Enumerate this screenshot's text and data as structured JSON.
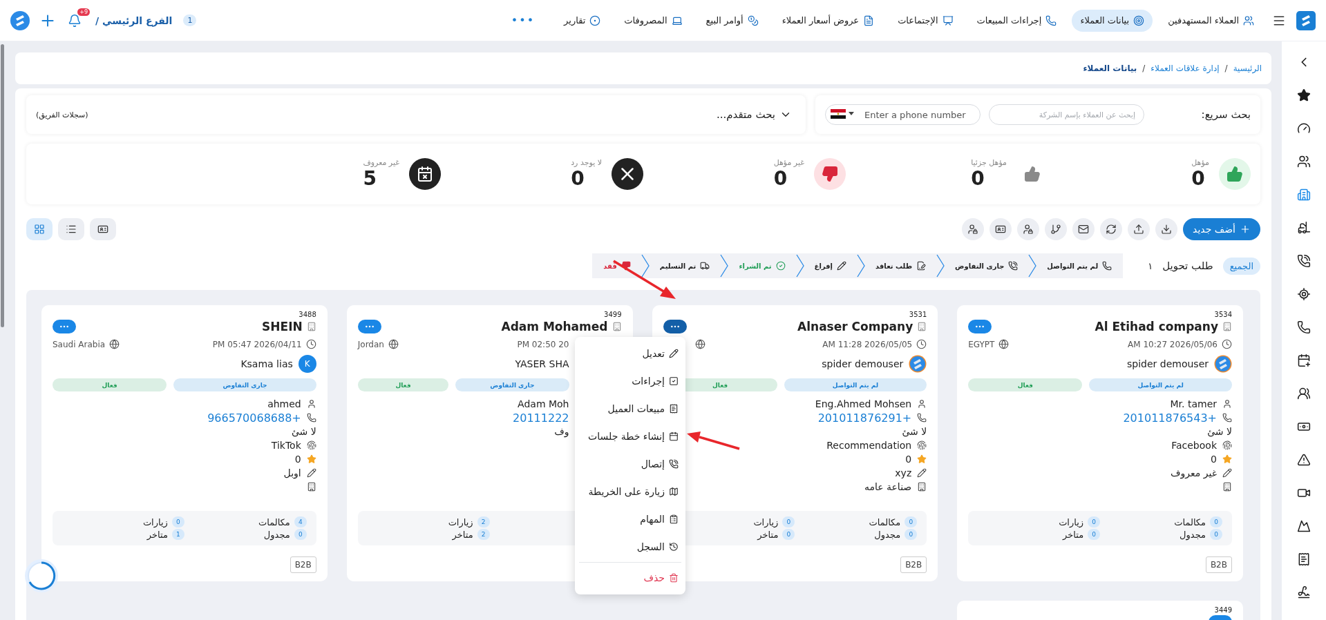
{
  "top_bar": {
    "nav": [
      {
        "label": "العملاء المستهدفين",
        "selected": false
      },
      {
        "label": "بيانات العملاء",
        "selected": true
      },
      {
        "label": "إجراءات المبيعات",
        "selected": false
      },
      {
        "label": "الإجتماعات",
        "selected": false
      },
      {
        "label": "عروض أسعار العملاء",
        "selected": false
      },
      {
        "label": "أوامر البيع",
        "selected": false
      },
      {
        "label": "المصروفات",
        "selected": false
      },
      {
        "label": "تقارير",
        "selected": false
      }
    ],
    "more": "•••",
    "branch": {
      "count": "1",
      "name": "الفرع الرئيسي /"
    },
    "notifications": "+9"
  },
  "sidebar": {
    "items": [
      {
        "selected": false
      },
      {
        "selected": false
      },
      {
        "selected": false
      },
      {
        "selected": true
      },
      {
        "selected": false
      },
      {
        "selected": false
      },
      {
        "selected": false
      },
      {
        "selected": false
      },
      {
        "selected": false
      },
      {
        "selected": false
      },
      {
        "selected": false
      },
      {
        "selected": false
      },
      {
        "selected": false
      },
      {
        "selected": false
      },
      {
        "selected": false
      },
      {
        "selected": false
      }
    ]
  },
  "breadcrumb": [
    {
      "label": "الرئيسية",
      "kind": "link"
    },
    {
      "label": "/",
      "kind": "separator"
    },
    {
      "label": "إدارة علاقات العملاء",
      "kind": "link"
    },
    {
      "label": "/",
      "kind": "separator"
    },
    {
      "label": "بيانات العملاء",
      "kind": "current"
    }
  ],
  "search": {
    "label": "بحث سريع:",
    "company_placeholder": "إبحث عن العملاء بإسم الشركة",
    "phone_placeholder": "Enter a phone number",
    "advanced": "بحث متقدم...",
    "team_records": "(سجلات الفريق)"
  },
  "summary": [
    {
      "kind": "qualified",
      "label": "مؤهل",
      "value": "0"
    },
    {
      "kind": "partial",
      "label": "مؤهل جزئيا",
      "value": "0"
    },
    {
      "kind": "unqualified",
      "label": "غير مؤهل",
      "value": "0"
    },
    {
      "kind": "no_reply",
      "label": "لا يوجد رد",
      "value": "0"
    },
    {
      "kind": "unknown",
      "label": "غير معروف",
      "value": "5"
    }
  ],
  "toolbar": {
    "add_label": "أضف جديد",
    "views": [
      {
        "selected": false
      },
      {
        "selected": false
      },
      {
        "selected": true
      }
    ]
  },
  "filter": {
    "all": {
      "label": "الجميع",
      "selected": true
    },
    "transfer": "طلب تحويل",
    "count": "١",
    "stages": [
      {
        "label": "لم يتم التواصل",
        "color": "#222222",
        "selected": false
      },
      {
        "label": "جارى التفاوض",
        "color": "#222222",
        "selected": false
      },
      {
        "label": "طلب تعاقد",
        "color": "#222222",
        "selected": false
      },
      {
        "label": "إفراغ",
        "color": "#222222",
        "selected": false
      },
      {
        "label": "تم الشراء",
        "color": "#1f9d55",
        "selected": false
      },
      {
        "label": "تم التسليم",
        "color": "#222222",
        "selected": false
      },
      {
        "label": "فُقد",
        "color": "#d9263b",
        "selected": false
      }
    ]
  },
  "cards": [
    {
      "id": "3534",
      "title": "Al Etihad company",
      "menu_open": false,
      "date": "AM 10:27 2026/05/06",
      "country": "EGYPT",
      "owner": {
        "name": "spider demouser",
        "kind": "logo"
      },
      "tags": [
        {
          "label": "لم يتم التواصل",
          "color": "#1a7fd4"
        },
        {
          "label": "فعال",
          "color": "#1f9d55"
        }
      ],
      "details": [
        {
          "kind": "person",
          "text": "Mr. tamer"
        },
        {
          "kind": "phone",
          "text": "201011876543+"
        },
        {
          "kind": "plain",
          "text": "لا شئ"
        },
        {
          "kind": "source",
          "text": "Facebook"
        },
        {
          "kind": "rating",
          "text": "0"
        },
        {
          "kind": "note",
          "text": "غير معروف"
        },
        {
          "kind": "industry"
        }
      ],
      "stats": {
        "column_1": [
          {
            "label": "مكالمات",
            "count": "0"
          },
          {
            "label": "مجدول",
            "count": "0"
          }
        ],
        "column_2": [
          {
            "label": "زيارات",
            "count": "0"
          },
          {
            "label": "متاخر",
            "count": "0"
          }
        ]
      },
      "badge": "B2B"
    },
    {
      "id": "3531",
      "title": "Alnaser Company",
      "menu_open": true,
      "date": "AM 11:28 2026/05/05",
      "owner": {
        "name": "spider demouser",
        "kind": "logo"
      },
      "tags": [
        {
          "label": "لم يتم التواصل",
          "color": "#1a7fd4"
        },
        {
          "label": "فعال",
          "color": "#1f9d55"
        }
      ],
      "details": [
        {
          "kind": "person",
          "text": "Eng.Ahmed Mohsen"
        },
        {
          "kind": "phone",
          "text": "201011876291+"
        },
        {
          "kind": "plain",
          "text": "لا شئ"
        },
        {
          "kind": "source",
          "text": "Recommendation"
        },
        {
          "kind": "rating",
          "text": "0"
        },
        {
          "kind": "note",
          "text": "xyz"
        },
        {
          "kind": "industry",
          "text": "صناعة عامه"
        }
      ],
      "stats": {
        "column_1": [
          {
            "label": "مكالمات",
            "count": "0"
          },
          {
            "label": "مجدول",
            "count": "0"
          }
        ],
        "column_2": [
          {
            "label": "زيارات",
            "count": "0"
          },
          {
            "label": "متاخر",
            "count": "0"
          }
        ]
      },
      "badge": "B2B"
    },
    {
      "id": "3499",
      "title": "Adam Mohamed",
      "menu_open": false,
      "covered": true,
      "date": "PM 02:50 20",
      "country": "Jordan",
      "owner": {
        "name": "YASER SHA"
      },
      "tags": [
        {
          "label": "جارى التفاوض",
          "color": "#1a7fd4"
        },
        {
          "label": "فعال",
          "color": "#1f9d55"
        }
      ],
      "details": [
        {
          "kind": "person",
          "text": "Adam Moh"
        },
        {
          "kind": "phone",
          "text": "20111222"
        },
        {
          "kind": "note",
          "text": "وف"
        }
      ],
      "stats": {
        "column_2": [
          {
            "label": "زيارات",
            "count": "2"
          },
          {
            "label": "متاخر",
            "count": "2"
          }
        ]
      }
    },
    {
      "id": "3488",
      "title": "SHEIN",
      "menu_open": false,
      "date": "PM 05:47 2026/04/11",
      "country": "Saudi Arabia",
      "owner": {
        "name": "Ksama lias",
        "kind": "letter",
        "avatar_letter": "K"
      },
      "tags": [
        {
          "label": "جارى التفاوض",
          "color": "#1a7fd4"
        },
        {
          "label": "فعال",
          "color": "#1f9d55"
        }
      ],
      "details": [
        {
          "kind": "person",
          "text": "ahmed"
        },
        {
          "kind": "phone",
          "text": "966570068688+"
        },
        {
          "kind": "plain",
          "text": "لا شئ"
        },
        {
          "kind": "source",
          "text": "TikTok"
        },
        {
          "kind": "rating",
          "text": "0"
        },
        {
          "kind": "note",
          "text": "اوبل"
        },
        {
          "kind": "industry"
        }
      ],
      "stats": {
        "column_1": [
          {
            "label": "مكالمات",
            "count": "4"
          },
          {
            "label": "مجدول",
            "count": "0"
          }
        ],
        "column_2": [
          {
            "label": "زيارات",
            "count": "0"
          },
          {
            "label": "متاخر",
            "count": "1"
          }
        ]
      },
      "badge": "B2B"
    },
    {
      "id": "3449",
      "menu_open": false
    }
  ],
  "menu": [
    {
      "label": "تعديل",
      "kind": "normal"
    },
    {
      "label": "إجراءات",
      "kind": "normal"
    },
    {
      "label": "مبيعات العميل",
      "kind": "normal"
    },
    {
      "label": "إنشاء خطة جلسات",
      "kind": "normal"
    },
    {
      "label": "إتصال",
      "kind": "normal"
    },
    {
      "label": "زيارة على الخريطة",
      "kind": "normal"
    },
    {
      "label": "المهام",
      "kind": "normal"
    },
    {
      "label": "السجل",
      "kind": "normal"
    },
    {
      "label": "حذف",
      "kind": "danger"
    }
  ]
}
